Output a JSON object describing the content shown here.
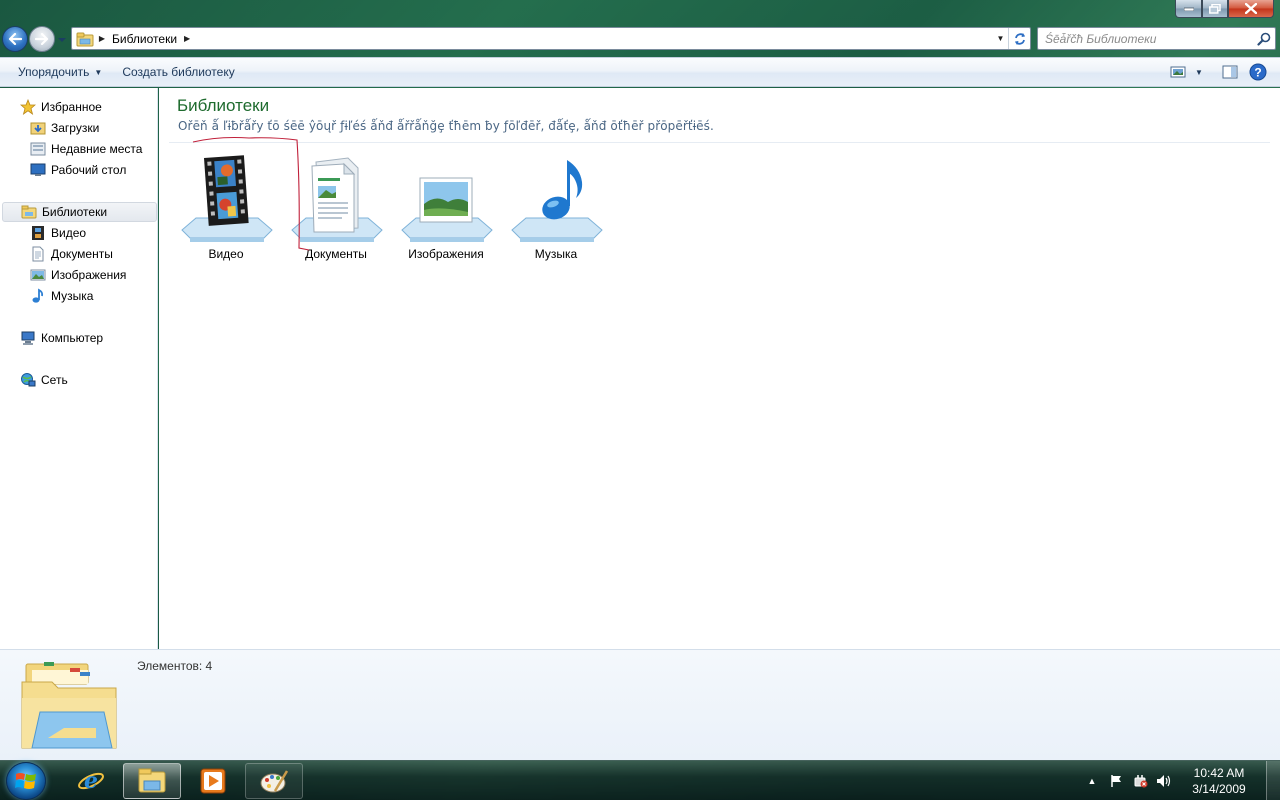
{
  "address_bar": {
    "crumbs": [
      "Библиотеки"
    ]
  },
  "search": {
    "placeholder": "Śēǡřčħ Библиотеки"
  },
  "command_bar": {
    "organize_label": "Упорядочить",
    "new_library_label": "Создать библиотеку"
  },
  "nav_pane": {
    "favorites": {
      "label": "Избранное",
      "items": [
        {
          "label": "Загрузки",
          "icon": "downloads-folder-icon"
        },
        {
          "label": "Недавние места",
          "icon": "recent-places-icon"
        },
        {
          "label": "Рабочий стол",
          "icon": "desktop-icon"
        }
      ]
    },
    "libraries": {
      "label": "Библиотеки",
      "items": [
        {
          "label": "Видео",
          "icon": "video-library-icon"
        },
        {
          "label": "Документы",
          "icon": "documents-library-icon"
        },
        {
          "label": "Изображения",
          "icon": "pictures-library-icon"
        },
        {
          "label": "Музыка",
          "icon": "music-library-icon"
        }
      ]
    },
    "computer": {
      "label": "Компьютер"
    },
    "network": {
      "label": "Сеть"
    }
  },
  "content": {
    "title": "Библиотеки",
    "description": "Ořēň ǻ ľɨƀřǻřy ťō śēē ŷōųř ƒɨľéś ǻňđ ǻřřǻňğȩ ťħēm ƀy ƒōľđēř, đǻťȩ, ǻňđ ōťħēř přōpēřťɨēś.",
    "libraries": [
      {
        "label": "Видео",
        "icon": "video-library-icon"
      },
      {
        "label": "Документы",
        "icon": "documents-library-icon"
      },
      {
        "label": "Изображения",
        "icon": "pictures-library-icon"
      },
      {
        "label": "Музыка",
        "icon": "music-library-icon"
      }
    ]
  },
  "details": {
    "items_count": "Элементов: 4"
  },
  "taskbar": {
    "time": "10:42 AM",
    "date": "3/14/2009"
  },
  "colors": {
    "title_green": "#1e6b2e",
    "link_blue": "#1e395b",
    "annotation_red": "#c0203a"
  }
}
